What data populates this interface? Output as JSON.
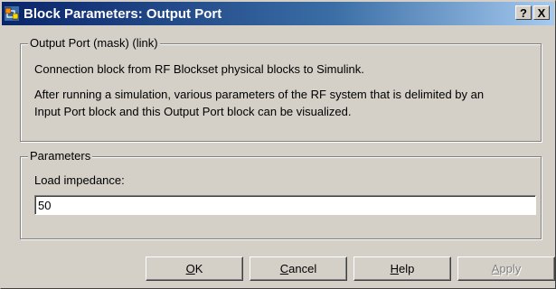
{
  "window": {
    "title": "Block Parameters: Output Port",
    "help_button_label": "?",
    "close_button_label": "X"
  },
  "mask_group": {
    "legend": "Output Port (mask) (link)",
    "description_line1": "Connection block from RF Blockset physical blocks to Simulink.",
    "description_line2": "After running a simulation, various parameters of the RF system that is delimited by an",
    "description_line3": "Input Port block and this Output Port block can be visualized."
  },
  "parameters_group": {
    "legend": "Parameters",
    "load_impedance_label": "Load impedance:",
    "load_impedance_value": "50"
  },
  "buttons": {
    "ok": {
      "mnemonic": "O",
      "rest": "K"
    },
    "cancel": {
      "mnemonic": "C",
      "rest": "ancel"
    },
    "help": {
      "mnemonic": "H",
      "rest": "elp"
    },
    "apply": {
      "mnemonic": "A",
      "rest": "pply",
      "enabled": false
    }
  }
}
